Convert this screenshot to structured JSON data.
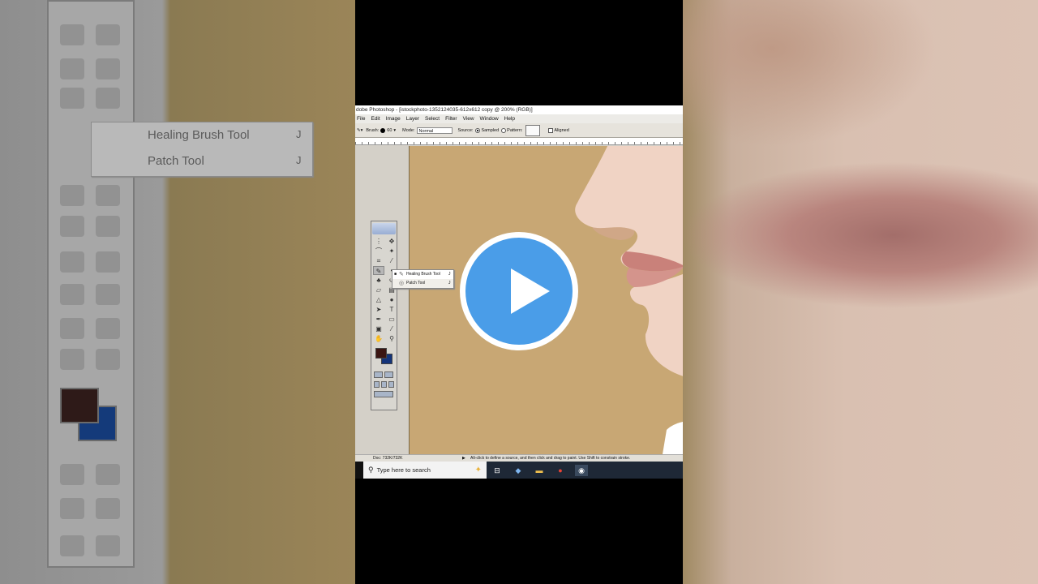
{
  "window": {
    "title": "dobe Photoshop - [istockphoto-1352124035-612x612 copy @ 200% (RGB)]"
  },
  "menu": [
    "File",
    "Edit",
    "Image",
    "Layer",
    "Select",
    "Filter",
    "View",
    "Window",
    "Help"
  ],
  "options_bar": {
    "brush_label": "Brush:",
    "brush_size": "60",
    "mode_label": "Mode:",
    "mode_value": "Normal",
    "source_label": "Source:",
    "sampled_label": "Sampled",
    "pattern_label": "Pattern:",
    "aligned_label": "Aligned"
  },
  "flyout": {
    "items": [
      {
        "label": "Healing Brush Tool",
        "key": "J"
      },
      {
        "label": "Patch Tool",
        "key": "J"
      }
    ]
  },
  "background_flyout": {
    "items": [
      {
        "label": "Healing Brush Tool",
        "key": "J"
      },
      {
        "label": "Patch Tool",
        "key": "J"
      }
    ]
  },
  "status_bar": {
    "doc": "Doc: 732K/732K",
    "hint": "Alt-click to define a source, and then click and drag to paint. Use Shift to constrain stroke."
  },
  "taskbar": {
    "search_placeholder": "Type here to search"
  },
  "colors": {
    "foreground": "#3a1512",
    "background": "#14347a",
    "canvas": "#c8a774",
    "play_button": "#4a9de8"
  }
}
